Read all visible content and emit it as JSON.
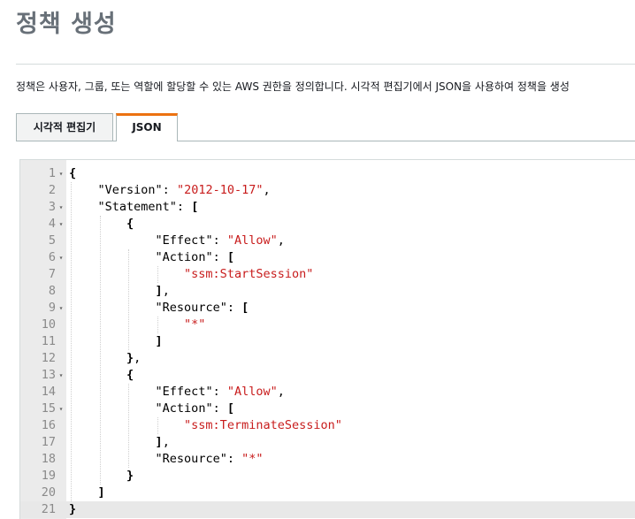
{
  "page": {
    "title": "정책 생성",
    "description": "정책은 사용자, 그룹, 또는 역할에 할당할 수 있는 AWS 권한을 정의합니다. 시각적 편집기에서 JSON을 사용하여 정책을 생성"
  },
  "tabs": [
    {
      "label": "시각적 편집기",
      "selected": false
    },
    {
      "label": "JSON",
      "selected": true
    }
  ],
  "editor": {
    "fold_icon": "triangle-down-icon",
    "active_line": 21,
    "lines": [
      {
        "num": "1",
        "fold": true,
        "tokens": [
          [
            "brk",
            "{"
          ]
        ]
      },
      {
        "num": "2",
        "fold": false,
        "tokens": [
          [
            "pad",
            "    "
          ],
          [
            "key",
            "\"Version\""
          ],
          [
            "punc",
            ": "
          ],
          [
            "str",
            "\"2012-10-17\""
          ],
          [
            "punc",
            ","
          ]
        ]
      },
      {
        "num": "3",
        "fold": true,
        "tokens": [
          [
            "pad",
            "    "
          ],
          [
            "key",
            "\"Statement\""
          ],
          [
            "punc",
            ": "
          ],
          [
            "brk",
            "["
          ]
        ]
      },
      {
        "num": "4",
        "fold": true,
        "tokens": [
          [
            "pad",
            "        "
          ],
          [
            "brk",
            "{"
          ]
        ]
      },
      {
        "num": "5",
        "fold": false,
        "tokens": [
          [
            "pad",
            "            "
          ],
          [
            "key",
            "\"Effect\""
          ],
          [
            "punc",
            ": "
          ],
          [
            "str",
            "\"Allow\""
          ],
          [
            "punc",
            ","
          ]
        ]
      },
      {
        "num": "6",
        "fold": true,
        "tokens": [
          [
            "pad",
            "            "
          ],
          [
            "key",
            "\"Action\""
          ],
          [
            "punc",
            ": "
          ],
          [
            "brk",
            "["
          ]
        ]
      },
      {
        "num": "7",
        "fold": false,
        "tokens": [
          [
            "pad",
            "                "
          ],
          [
            "str",
            "\"ssm:StartSession\""
          ]
        ]
      },
      {
        "num": "8",
        "fold": false,
        "tokens": [
          [
            "pad",
            "            "
          ],
          [
            "brk",
            "]"
          ],
          [
            "punc",
            ","
          ]
        ]
      },
      {
        "num": "9",
        "fold": true,
        "tokens": [
          [
            "pad",
            "            "
          ],
          [
            "key",
            "\"Resource\""
          ],
          [
            "punc",
            ": "
          ],
          [
            "brk",
            "["
          ]
        ]
      },
      {
        "num": "10",
        "fold": false,
        "tokens": [
          [
            "pad",
            "                "
          ],
          [
            "str",
            "\"*\""
          ]
        ]
      },
      {
        "num": "11",
        "fold": false,
        "tokens": [
          [
            "pad",
            "            "
          ],
          [
            "brk",
            "]"
          ]
        ]
      },
      {
        "num": "12",
        "fold": false,
        "tokens": [
          [
            "pad",
            "        "
          ],
          [
            "brk",
            "}"
          ],
          [
            "punc",
            ","
          ]
        ]
      },
      {
        "num": "13",
        "fold": true,
        "tokens": [
          [
            "pad",
            "        "
          ],
          [
            "brk",
            "{"
          ]
        ]
      },
      {
        "num": "14",
        "fold": false,
        "tokens": [
          [
            "pad",
            "            "
          ],
          [
            "key",
            "\"Effect\""
          ],
          [
            "punc",
            ": "
          ],
          [
            "str",
            "\"Allow\""
          ],
          [
            "punc",
            ","
          ]
        ]
      },
      {
        "num": "15",
        "fold": true,
        "tokens": [
          [
            "pad",
            "            "
          ],
          [
            "key",
            "\"Action\""
          ],
          [
            "punc",
            ": "
          ],
          [
            "brk",
            "["
          ]
        ]
      },
      {
        "num": "16",
        "fold": false,
        "tokens": [
          [
            "pad",
            "                "
          ],
          [
            "str",
            "\"ssm:TerminateSession\""
          ]
        ]
      },
      {
        "num": "17",
        "fold": false,
        "tokens": [
          [
            "pad",
            "            "
          ],
          [
            "brk",
            "]"
          ],
          [
            "punc",
            ","
          ]
        ]
      },
      {
        "num": "18",
        "fold": false,
        "tokens": [
          [
            "pad",
            "            "
          ],
          [
            "key",
            "\"Resource\""
          ],
          [
            "punc",
            ": "
          ],
          [
            "str",
            "\"*\""
          ]
        ]
      },
      {
        "num": "19",
        "fold": false,
        "tokens": [
          [
            "pad",
            "        "
          ],
          [
            "brk",
            "}"
          ]
        ]
      },
      {
        "num": "20",
        "fold": false,
        "tokens": [
          [
            "pad",
            "    "
          ],
          [
            "brk",
            "]"
          ]
        ]
      },
      {
        "num": "21",
        "fold": false,
        "tokens": [
          [
            "brk",
            "}"
          ]
        ]
      }
    ]
  }
}
